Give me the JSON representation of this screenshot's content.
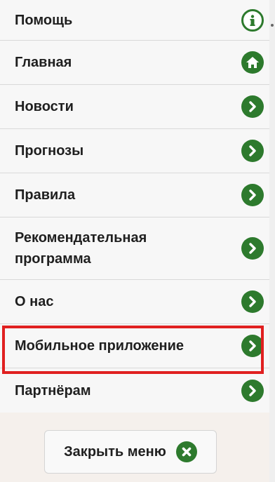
{
  "menu": {
    "items": [
      {
        "label": "Помощь",
        "icon": "info-icon"
      },
      {
        "label": "Главная",
        "icon": "home-icon"
      },
      {
        "label": "Новости",
        "icon": "chevron-right-icon"
      },
      {
        "label": "Прогнозы",
        "icon": "chevron-right-icon"
      },
      {
        "label": "Правила",
        "icon": "chevron-right-icon"
      },
      {
        "label": "Рекомендательная программа",
        "icon": "chevron-right-icon"
      },
      {
        "label": "О нас",
        "icon": "chevron-right-icon"
      },
      {
        "label": "Мобильное приложение",
        "icon": "chevron-right-icon",
        "highlighted": true
      },
      {
        "label": "Партнёрам",
        "icon": "chevron-right-icon"
      }
    ]
  },
  "close_button": {
    "label": "Закрыть меню",
    "icon": "close-x-icon"
  },
  "colors": {
    "accent_green": "#2d7a2d",
    "highlight_red": "#e02020",
    "menu_background": "#f7f7f7",
    "page_background": "#f5f0ec"
  }
}
